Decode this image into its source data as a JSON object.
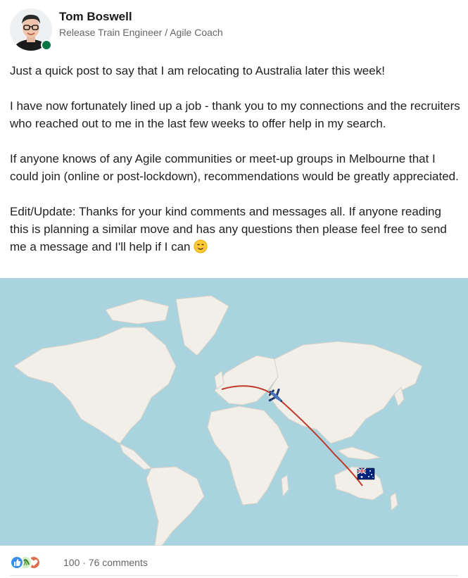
{
  "author": {
    "name": "Tom Boswell",
    "headline": "Release Train Engineer / Agile Coach",
    "status_color": "#057642"
  },
  "post": {
    "paragraphs": [
      "Just a quick post to say that I am relocating to Australia later this week!",
      "I have now fortunately lined up a job - thank you to my connections and the recruiters who reached out to me in the last few weeks to offer help in my search.",
      "If anyone knows of any Agile communities or meet-up groups in Melbourne that I could join (online or post-lockdown), recommendations would be greatly appreciated.",
      "Edit/Update: Thanks for your kind comments and messages all. If anyone reading this is planning a similar move and has any questions then please feel free to send me a message and I'll help if I can"
    ],
    "end_emoji": "smiling-face-icon"
  },
  "image": {
    "type": "world-map",
    "route_color": "#c0392b",
    "ocean_color": "#a9d4df",
    "land_color": "#f2efe9",
    "icons": [
      "airplane-icon",
      "australia-flag-icon"
    ]
  },
  "social": {
    "reactions": [
      "like-icon",
      "support-icon",
      "love-icon"
    ],
    "counts_text": "100 · 76 comments"
  }
}
